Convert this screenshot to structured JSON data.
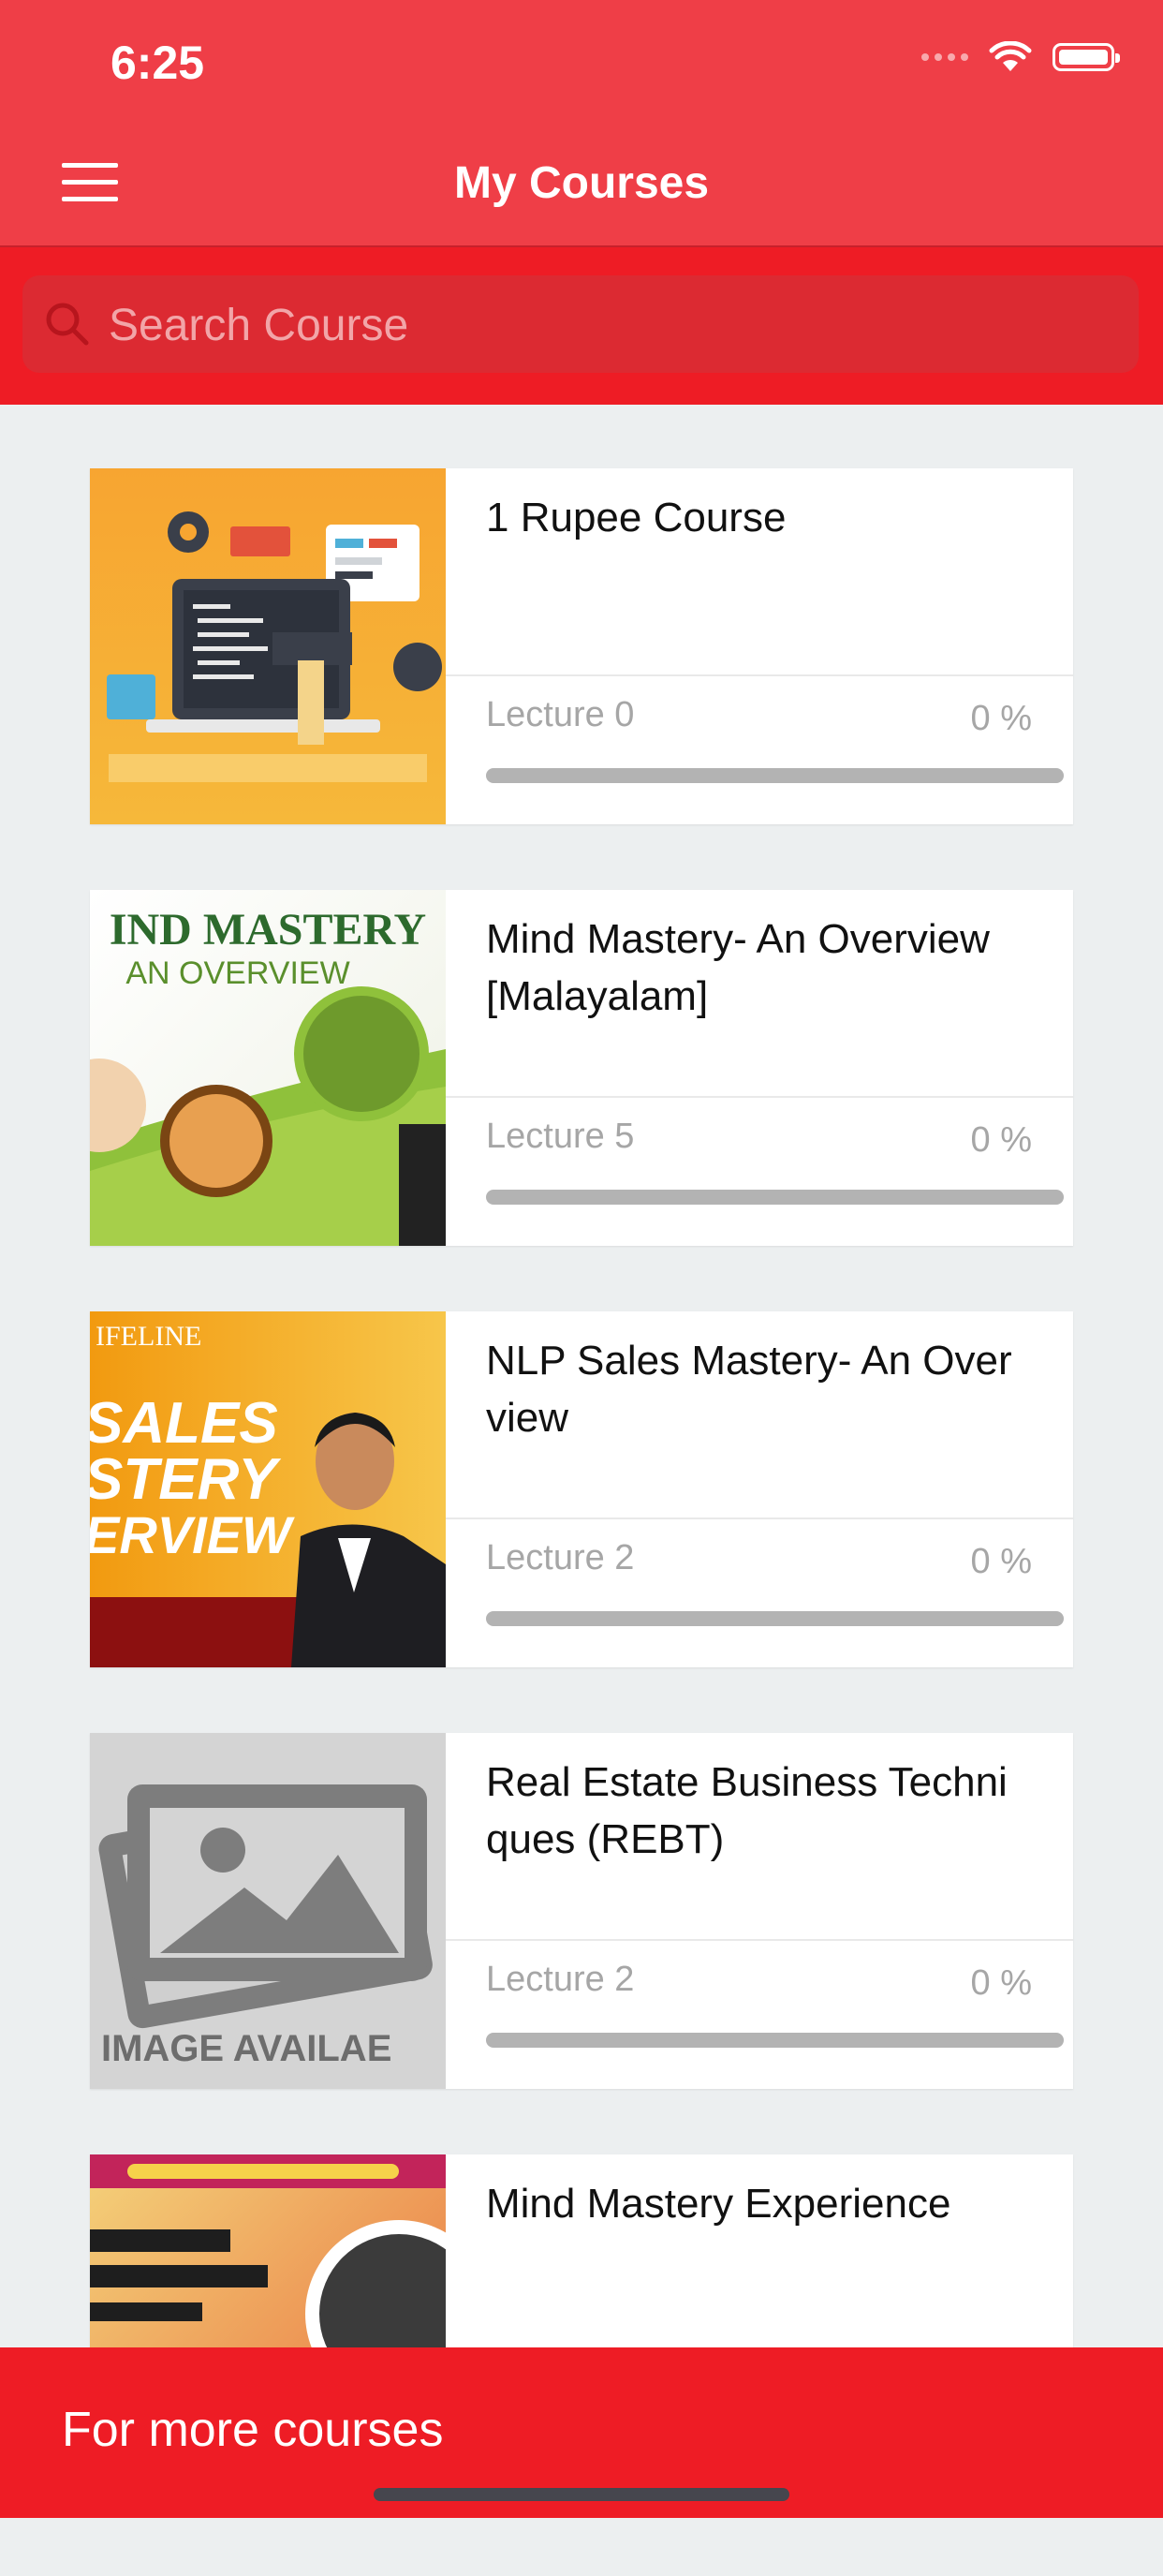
{
  "status_bar": {
    "time": "6:25"
  },
  "header": {
    "title": "My Courses"
  },
  "search": {
    "placeholder": "Search Course",
    "value": ""
  },
  "courses": [
    {
      "title": "1 Rupee Course",
      "lecture": "Lecture 0",
      "percent": "0 %",
      "progress": 0
    },
    {
      "title": "Mind Mastery- An Overview [Malayalam]",
      "lecture": "Lecture 5",
      "percent": "0 %",
      "progress": 0,
      "thumb_text": {
        "line1": "IND MASTERY",
        "line2": "AN OVERVIEW"
      }
    },
    {
      "title": "NLP Sales Mastery- An Over view",
      "lecture": "Lecture 2",
      "percent": "0 %",
      "progress": 0,
      "thumb_text": {
        "brand": "IFELINE",
        "line1": "SALES",
        "line2": "STERY",
        "line3": "ERVIEW"
      }
    },
    {
      "title": "Real Estate Business Techni ques (REBT)",
      "lecture": "Lecture 2",
      "percent": "0 %",
      "progress": 0,
      "thumb_text": {
        "caption": "IMAGE AVAILAE"
      }
    },
    {
      "title": "Mind Mastery Experience"
    }
  ],
  "footer": {
    "label": "For more courses"
  },
  "colors": {
    "brand": "#ef3e47",
    "footer": "#ee1c25",
    "search_field": "#dc2a32"
  }
}
